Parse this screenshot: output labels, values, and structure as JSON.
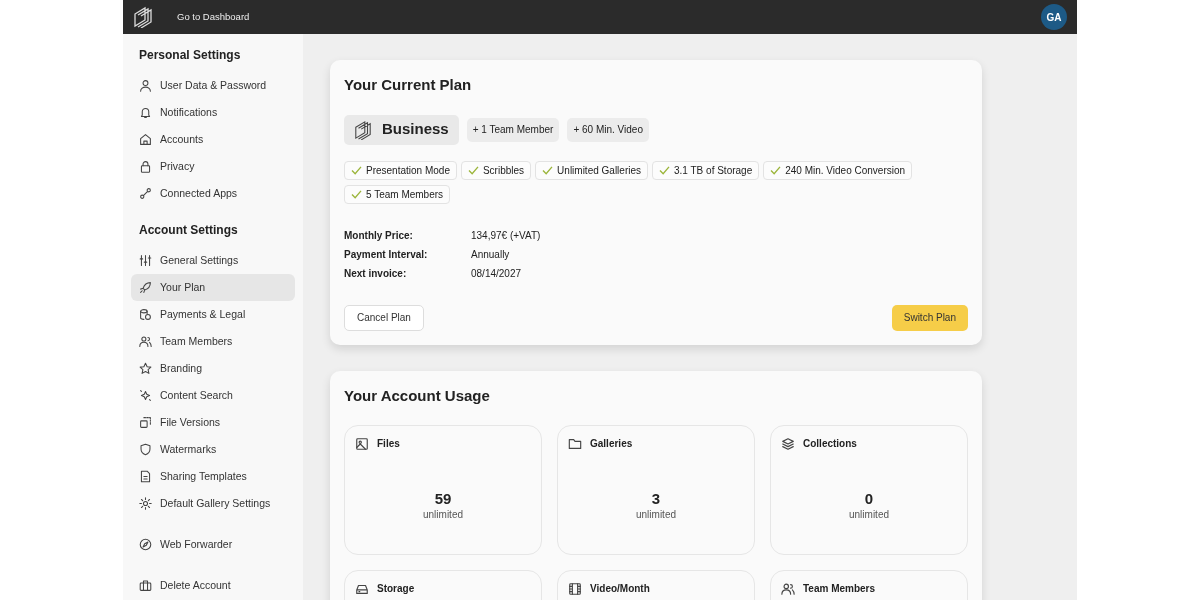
{
  "topbar": {
    "link": "Go to Dashboard",
    "avatar": "GA"
  },
  "sidebar": {
    "sections": [
      {
        "title": "Personal Settings",
        "items": [
          {
            "label": "User Data & Password",
            "selected": false
          },
          {
            "label": "Notifications",
            "selected": false
          },
          {
            "label": "Accounts",
            "selected": false
          },
          {
            "label": "Privacy",
            "selected": false
          },
          {
            "label": "Connected Apps",
            "selected": false
          }
        ]
      },
      {
        "title": "Account Settings",
        "items": [
          {
            "label": "General Settings",
            "selected": false
          },
          {
            "label": "Your Plan",
            "selected": true
          },
          {
            "label": "Payments & Legal",
            "selected": false
          },
          {
            "label": "Team Members",
            "selected": false
          },
          {
            "label": "Branding",
            "selected": false
          },
          {
            "label": "Content Search",
            "selected": false
          },
          {
            "label": "File Versions",
            "selected": false
          },
          {
            "label": "Watermarks",
            "selected": false
          },
          {
            "label": "Sharing Templates",
            "selected": false
          },
          {
            "label": "Default Gallery Settings",
            "selected": false
          }
        ]
      },
      {
        "items": [
          {
            "label": "Web Forwarder",
            "selected": false
          }
        ]
      },
      {
        "items": [
          {
            "label": "Delete Account",
            "selected": false
          }
        ]
      }
    ]
  },
  "plan": {
    "title": "Your Current Plan",
    "name": "Business",
    "addons": [
      "+ 1 Team Member",
      "+ 60 Min. Video"
    ],
    "features": [
      "Presentation Mode",
      "Scribbles",
      "Unlimited Galleries",
      "3.1 TB of Storage",
      "240 Min. Video Conversion",
      "5 Team Members"
    ],
    "details": [
      {
        "label": "Monthly Price:",
        "value": "134,97€ (+VAT)"
      },
      {
        "label": "Payment Interval:",
        "value": "Annually"
      },
      {
        "label": "Next invoice:",
        "value": "08/14/2027"
      }
    ],
    "cancel_button": "Cancel Plan",
    "switch_button": "Switch Plan"
  },
  "usage": {
    "title": "Your Account Usage",
    "cards": [
      {
        "label": "Files",
        "value": "59",
        "limit": "unlimited"
      },
      {
        "label": "Galleries",
        "value": "3",
        "limit": "unlimited"
      },
      {
        "label": "Collections",
        "value": "0",
        "limit": "unlimited"
      },
      {
        "label": "Storage"
      },
      {
        "label": "Video/Month"
      },
      {
        "label": "Team Members"
      }
    ]
  }
}
